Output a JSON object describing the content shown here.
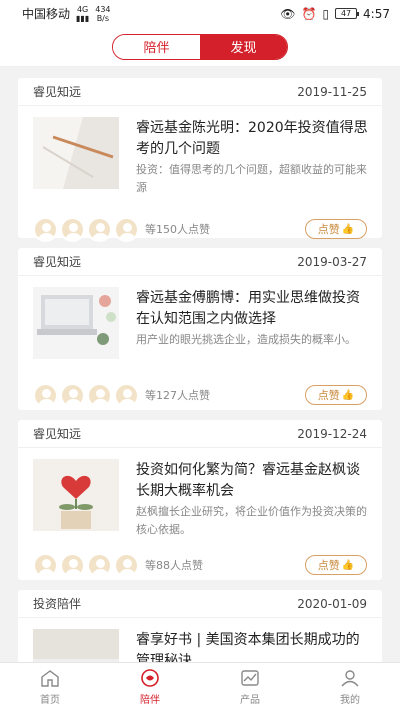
{
  "status_bar": {
    "carrier": "中国移动",
    "network": "4G",
    "speed": "434",
    "speed_unit": "B/s",
    "battery": "47",
    "time": "4:57"
  },
  "header": {
    "tabs": [
      {
        "label": "陪伴",
        "active": false
      },
      {
        "label": "发现",
        "active": true
      }
    ]
  },
  "feed": [
    {
      "source": "睿见知远",
      "date": "2019-11-25",
      "title": "睿远基金陈光明：2020年投资值得思考的几个问题",
      "desc": "投资：值得思考的几个问题，超额收益的可能来源",
      "likes": "等150人点赞",
      "like_label": "点赞",
      "thumb_icon": "pen-paper-photo"
    },
    {
      "source": "睿见知远",
      "date": "2019-03-27",
      "title": "睿远基金傅鹏博：用实业思维做投资 在认知范围之内做选择",
      "desc": "用产业的眼光挑选企业，造成损失的概率小。",
      "likes": "等127人点赞",
      "like_label": "点赞",
      "thumb_icon": "laptop-flowers-photo"
    },
    {
      "source": "睿见知远",
      "date": "2019-12-24",
      "title": "投资如何化繁为简？睿远基金赵枫谈长期大概率机会",
      "desc": "赵枫擅长企业研究，将企业价值作为投资决策的核心依据。",
      "likes": "等88人点赞",
      "like_label": "点赞",
      "thumb_icon": "heart-plant-photo"
    },
    {
      "source": "投资陪伴",
      "date": "2020-01-09",
      "title": "睿享好书 | 美国资本集团长期成功的管理秘诀",
      "desc": "",
      "likes": "",
      "like_label": "",
      "thumb_icon": "book-photo"
    }
  ],
  "tabbar": [
    {
      "label": "首页",
      "icon": "home-icon",
      "active": false
    },
    {
      "label": "陪伴",
      "icon": "companion-icon",
      "active": true
    },
    {
      "label": "产品",
      "icon": "chart-icon",
      "active": false
    },
    {
      "label": "我的",
      "icon": "profile-icon",
      "active": false
    }
  ],
  "colors": {
    "accent": "#d4202a",
    "like": "#c98a3e",
    "avatar": "#f2e3c8"
  }
}
